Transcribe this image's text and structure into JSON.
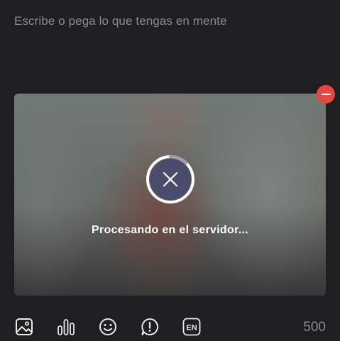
{
  "composer": {
    "placeholder": "Escribe o pega lo que tengas en mente"
  },
  "attachment": {
    "status_text": "Procesando en el servidor...",
    "progress": 0.12
  },
  "toolbar": {
    "language_label": "EN",
    "icons": [
      "image-icon",
      "poll-icon",
      "emoji-icon",
      "alert-icon",
      "language-icon"
    ],
    "char_count": "500"
  },
  "colors": {
    "background": "#1f1f21",
    "remove": "#e8463f",
    "cancel": "#4a4c6b",
    "icon": "#e9e9ea",
    "muted": "#8b8b90"
  }
}
